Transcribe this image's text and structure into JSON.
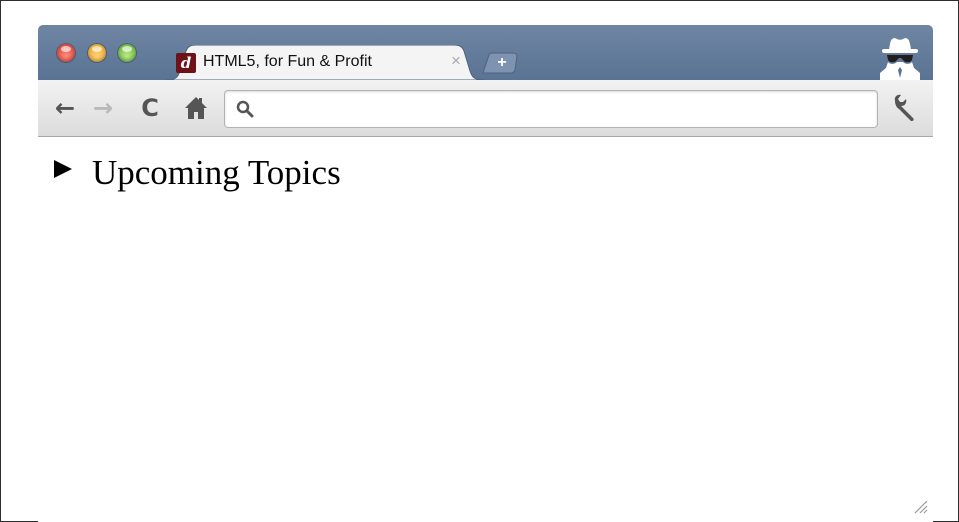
{
  "browser": {
    "tab": {
      "title": "HTML5, for Fun & Profit",
      "favicon_letter": "d",
      "close_label": "×"
    },
    "new_tab_label": "+",
    "toolbar": {
      "back_icon": "←",
      "forward_icon": "→",
      "reload_icon": "C",
      "home_icon": "home-icon",
      "search": {
        "value": "",
        "placeholder": ""
      }
    }
  },
  "page": {
    "details": {
      "summary": "Upcoming Topics",
      "open": false
    }
  },
  "colors": {
    "tabstrip": "#5a7394",
    "favicon": "#6e1219",
    "toolbar": "#e6e6e6"
  }
}
